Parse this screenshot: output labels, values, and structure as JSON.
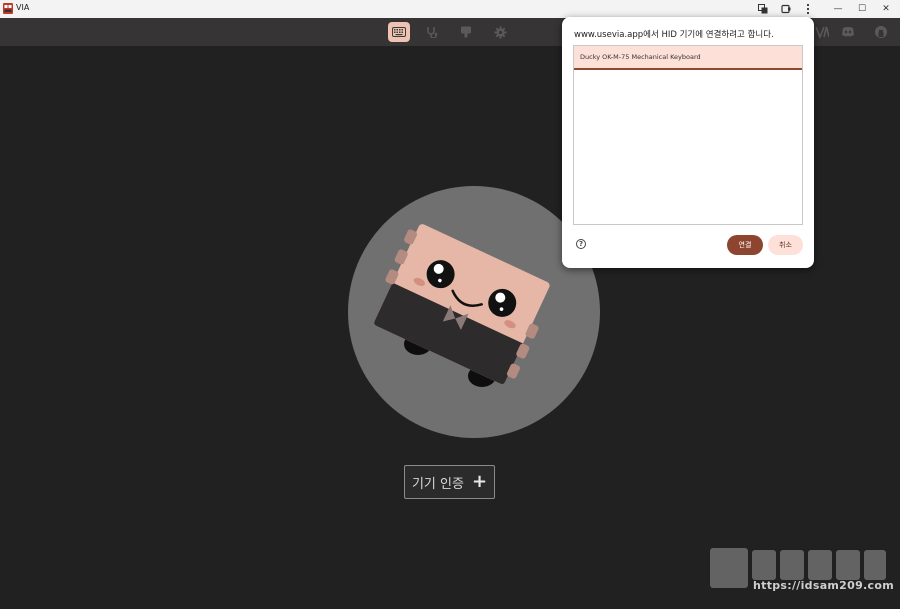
{
  "window": {
    "title": "VIA",
    "controls": {
      "minimize": "—",
      "maximize": "☐",
      "close": "✕"
    }
  },
  "toolbar": {
    "items": [
      {
        "icon": "keyboard-icon",
        "active": true
      },
      {
        "icon": "stethoscope-icon",
        "active": false
      },
      {
        "icon": "design-icon",
        "active": false
      },
      {
        "icon": "gear-icon",
        "active": false
      }
    ]
  },
  "main": {
    "auth_button_label": "기기 인증",
    "auth_button_plus": "+"
  },
  "dialog": {
    "title": "www.usevia.app에서 HID 기기에 연결하려고 합니다.",
    "devices": [
      {
        "name": "Ducky OK-M-75 Mechanical Keyboard",
        "selected": true
      }
    ],
    "help_glyph": "?",
    "connect_label": "연결",
    "cancel_label": "취소"
  },
  "watermark": {
    "url": "https://idsam209.com"
  },
  "colors": {
    "background": "#222122",
    "toolbar": "#363435",
    "accent": "#efc3b2",
    "primary_button": "#8e4530",
    "secondary_button": "#fde1d8"
  }
}
